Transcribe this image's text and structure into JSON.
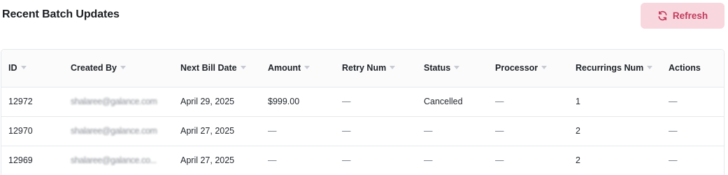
{
  "page": {
    "title": "Recent Batch Updates",
    "refresh_label": "Refresh",
    "refresh_icon": "refresh-icon"
  },
  "table": {
    "columns": [
      "ID",
      "Created By",
      "Next Bill Date",
      "Amount",
      "Retry Num",
      "Status",
      "Processor",
      "Recurrings Num",
      "Actions"
    ],
    "sortable": [
      true,
      true,
      true,
      true,
      true,
      true,
      true,
      true,
      false
    ],
    "rows": [
      {
        "id": "12972",
        "created_by": "shalaree@galance.com",
        "next_bill_date": "April 29, 2025",
        "amount": "$999.00",
        "retry_num": "—",
        "status": "Cancelled",
        "processor": "—",
        "recurrings_num": "1",
        "actions": "—"
      },
      {
        "id": "12970",
        "created_by": "shalaree@galance.com",
        "next_bill_date": "April 27, 2025",
        "amount": "—",
        "retry_num": "—",
        "status": "—",
        "processor": "—",
        "recurrings_num": "2",
        "actions": "—"
      },
      {
        "id": "12969",
        "created_by": "shalaree@galance.co...",
        "next_bill_date": "April 27, 2025",
        "amount": "—",
        "retry_num": "—",
        "status": "—",
        "processor": "—",
        "recurrings_num": "2",
        "actions": "—"
      }
    ]
  },
  "colors": {
    "accent": "#c23b5b",
    "accent_bg": "#f8d7df",
    "border": "#e6e8eb"
  }
}
